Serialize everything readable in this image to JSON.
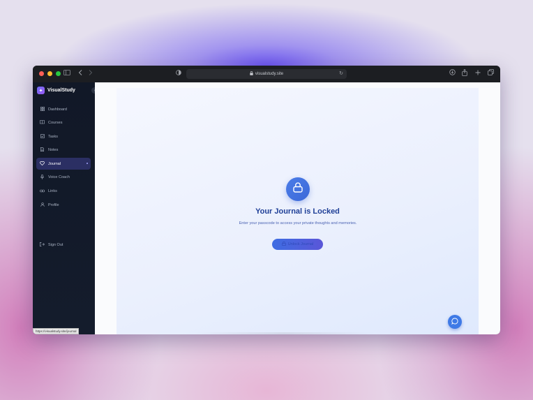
{
  "browser": {
    "url": "visualstudy.site",
    "status_url": "https://visualstudy.site/journal"
  },
  "sidebar": {
    "brand": "VisualStudy",
    "items": [
      {
        "label": "Dashboard",
        "icon": "grid-icon"
      },
      {
        "label": "Courses",
        "icon": "book-icon"
      },
      {
        "label": "Tasks",
        "icon": "checkbox-icon"
      },
      {
        "label": "Notes",
        "icon": "document-icon"
      },
      {
        "label": "Journal",
        "icon": "heart-icon",
        "active": true
      },
      {
        "label": "Voice Coach",
        "icon": "microphone-icon"
      },
      {
        "label": "Links",
        "icon": "link-icon"
      },
      {
        "label": "Profile",
        "icon": "user-icon"
      }
    ],
    "sign_out": "Sign Out"
  },
  "main": {
    "title": "Your Journal is Locked",
    "description": "Enter your passcode to access your private thoughts and memories.",
    "unlock_label": "Unlock Journal"
  },
  "colors": {
    "accent": "#3c68d8",
    "title": "#1f3f97",
    "sidebar_bg": "#111827",
    "active_item": "#2b2f63"
  }
}
